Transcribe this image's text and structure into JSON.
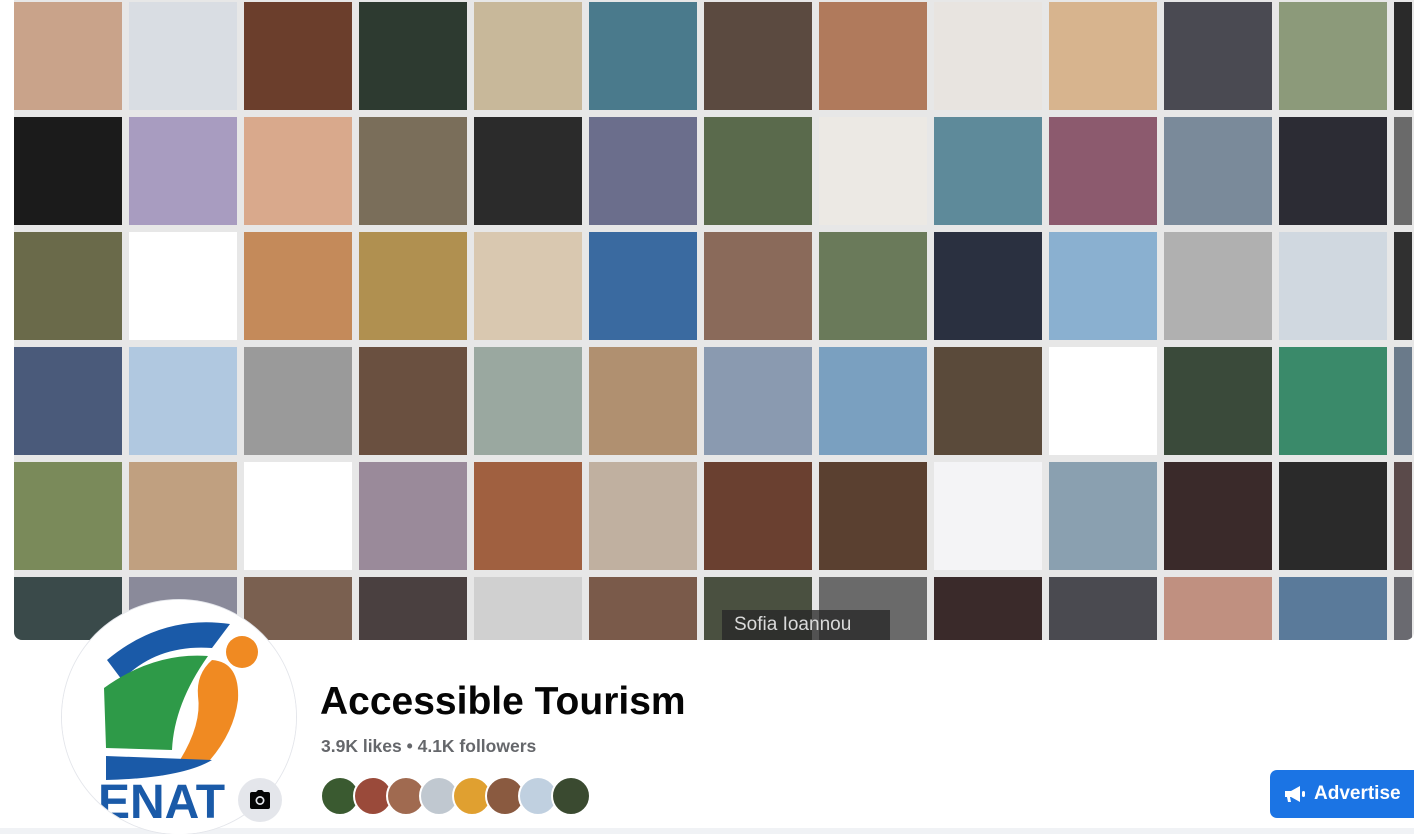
{
  "cover": {
    "tooltip": "Sofia Ioannou",
    "tile_colors": [
      "#c9a38a",
      "#d9dde3",
      "#6b3e2c",
      "#2d3a30",
      "#c8b89a",
      "#4a7a8c",
      "#5b4a40",
      "#b07a5c",
      "#e8e4e0",
      "#d7b48e",
      "#4a4a52",
      "#8c9a7a",
      "#2a2a2a",
      "#1b1b1b",
      "#a89cc0",
      "#d9a98c",
      "#7a6e5a",
      "#2b2b2b",
      "#6b6e8c",
      "#5a6a4c",
      "#ece9e4",
      "#5e8a9a",
      "#8c5a6e",
      "#7a8a9a",
      "#2c2c34",
      "#6a6a6a",
      "#6a6a4a",
      "#ffffff",
      "#c48a5a",
      "#b09050",
      "#d9c8b0",
      "#3a6aa0",
      "#8a6a5a",
      "#6a7a5a",
      "#2a3040",
      "#8ab0d0",
      "#b0b0b0",
      "#d0d8e0",
      "#303030",
      "#4a5a7a",
      "#b0c8e0",
      "#9a9a9a",
      "#6a5040",
      "#9aa8a0",
      "#b09070",
      "#8a9ab0",
      "#7aa0c0",
      "#5a4a3a",
      "#ffffff",
      "#3a4a3a",
      "#3a8a6a",
      "#6a7a8a",
      "#7a8a5a",
      "#c0a080",
      "#ffffff",
      "#9a8a9a",
      "#a06040",
      "#c0b0a0",
      "#6a4030",
      "#5a4030",
      "#f4f4f6",
      "#8aa0b0",
      "#3a2a2a",
      "#2a2a2a",
      "#5a4a4a",
      "#3a4a4a",
      "#8a8a9a",
      "#7a6050",
      "#4a4040",
      "#d0d0d0",
      "#7a5a4a",
      "#4a5040",
      "#6a6a6a",
      "#3a2a2a",
      "#4a4a50",
      "#c09080",
      "#5a7a9a",
      "#6a6a70"
    ],
    "tile_names": [
      "profile-photo-man",
      "default-profile-silhouette",
      "profile-photo-woman",
      "text-logo-chr",
      "cartoon-figures",
      "underwater-scene",
      "profile-photo-man",
      "profile-photo-woman",
      "profile-photo-man",
      "profile-photo-woman",
      "profile-photo-man",
      "window-photo",
      "partial-tile"
    ]
  },
  "profile": {
    "logo_text": "ENAT",
    "logo_colors": {
      "blue": "#1a5aa8",
      "green": "#2e9a48",
      "orange": "#f08a22",
      "text": "#1a5aa8"
    }
  },
  "page": {
    "title": "Accessible Tourism",
    "stats": "3.9K likes • 4.1K followers"
  },
  "friends": {
    "colors": [
      "#3a5a30",
      "#9a4a3a",
      "#a06a50",
      "#c0c8d0",
      "#e0a030",
      "#8a5a40",
      "#c0d0e0",
      "#3a4a30"
    ]
  },
  "actions": {
    "advertise_label": "Advertise",
    "accent": "#1b74e4"
  }
}
